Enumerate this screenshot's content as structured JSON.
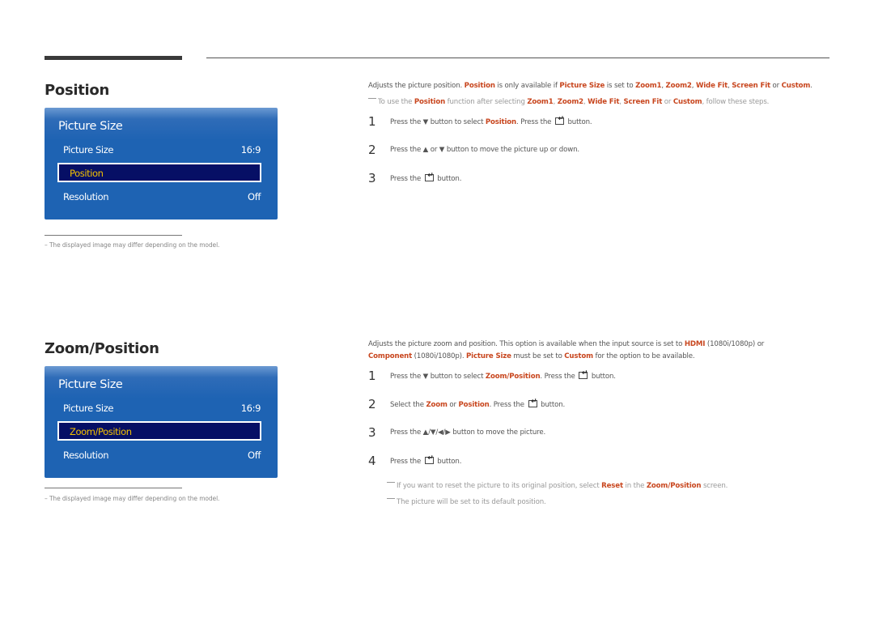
{
  "sections": [
    {
      "title": "Position",
      "osd": {
        "title": "Picture Size",
        "rows": [
          {
            "label": "Picture Size",
            "value": "16:9"
          },
          {
            "label": "Position",
            "value": ""
          },
          {
            "label": "Resolution",
            "value": "Off"
          }
        ],
        "selected": "Position"
      },
      "footnote": "The displayed image may differ depending on the model.",
      "description": [
        {
          "t": "Adjusts the picture position. "
        },
        {
          "t": "Position",
          "h": true
        },
        {
          "t": " is only available if "
        },
        {
          "t": "Picture Size",
          "h": true
        },
        {
          "t": " is set to "
        },
        {
          "t": "Zoom1",
          "h": true
        },
        {
          "t": ", "
        },
        {
          "t": "Zoom2",
          "h": true
        },
        {
          "t": ", "
        },
        {
          "t": "Wide Fit",
          "h": true
        },
        {
          "t": ", "
        },
        {
          "t": "Screen Fit",
          "h": true
        },
        {
          "t": " or "
        },
        {
          "t": "Custom",
          "h": true
        },
        {
          "t": "."
        }
      ],
      "note": [
        {
          "t": "To use the "
        },
        {
          "t": "Position",
          "h": true
        },
        {
          "t": " function after selecting "
        },
        {
          "t": "Zoom1",
          "h": true
        },
        {
          "t": ", "
        },
        {
          "t": "Zoom2",
          "h": true
        },
        {
          "t": ", "
        },
        {
          "t": "Wide Fit",
          "h": true
        },
        {
          "t": ", "
        },
        {
          "t": "Screen Fit",
          "h": true
        },
        {
          "t": " or "
        },
        {
          "t": "Custom",
          "h": true
        },
        {
          "t": ", follow these steps."
        }
      ],
      "steps": [
        {
          "num": "1",
          "parts": [
            {
              "t": "Press the ▼ button to select "
            },
            {
              "t": "Position",
              "h": true
            },
            {
              "t": ". Press the "
            },
            {
              "icon": "enter"
            },
            {
              "t": " button."
            }
          ]
        },
        {
          "num": "2",
          "parts": [
            {
              "t": "Press the ▲ or ▼ button to move the picture up or down."
            }
          ]
        },
        {
          "num": "3",
          "parts": [
            {
              "t": "Press the "
            },
            {
              "icon": "enter"
            },
            {
              "t": " button."
            }
          ]
        }
      ]
    },
    {
      "title": "Zoom/Position",
      "osd": {
        "title": "Picture Size",
        "rows": [
          {
            "label": "Picture Size",
            "value": "16:9"
          },
          {
            "label": "Zoom/Position",
            "value": ""
          },
          {
            "label": "Resolution",
            "value": "Off"
          }
        ],
        "selected": "Zoom/Position"
      },
      "footnote": "The displayed image may differ depending on the model.",
      "description": [
        {
          "t": "Adjusts the picture zoom and position. This option is available when the input source is set to "
        },
        {
          "t": "HDMI",
          "h": true
        },
        {
          "t": " (1080i/1080p) or "
        },
        {
          "br": true
        },
        {
          "t": "Component",
          "h": true
        },
        {
          "t": " (1080i/1080p). "
        },
        {
          "t": "Picture Size",
          "h": true
        },
        {
          "t": " must be set to "
        },
        {
          "t": "Custom",
          "h": true
        },
        {
          "t": " for the option to be available."
        }
      ],
      "steps": [
        {
          "num": "1",
          "parts": [
            {
              "t": "Press the ▼ button to select "
            },
            {
              "t": "Zoom/Position",
              "h": true
            },
            {
              "t": ". Press the "
            },
            {
              "icon": "enter"
            },
            {
              "t": " button."
            }
          ]
        },
        {
          "num": "2",
          "parts": [
            {
              "t": "Select the "
            },
            {
              "t": "Zoom",
              "h": true
            },
            {
              "t": " or "
            },
            {
              "t": "Position",
              "h": true
            },
            {
              "t": ". Press the "
            },
            {
              "icon": "enter"
            },
            {
              "t": " button."
            }
          ]
        },
        {
          "num": "3",
          "parts": [
            {
              "t": "Press the ▲/▼/◀/▶ button to move the picture."
            }
          ]
        },
        {
          "num": "4",
          "parts": [
            {
              "t": "Press the "
            },
            {
              "icon": "enter"
            },
            {
              "t": " button."
            }
          ]
        }
      ],
      "notes": [
        [
          {
            "t": "If you want to reset the picture to its original position, select "
          },
          {
            "t": "Reset",
            "h": true
          },
          {
            "t": " in the "
          },
          {
            "t": "Zoom/Position",
            "h": true
          },
          {
            "t": " screen."
          }
        ],
        [
          {
            "t": "The picture will be set to its default position."
          }
        ]
      ]
    }
  ],
  "colors": {
    "highlight": "#c8461e",
    "osd_blue": "#1e63b3",
    "osd_selected_bg": "#060f65",
    "osd_selected_text": "#f5c200"
  }
}
